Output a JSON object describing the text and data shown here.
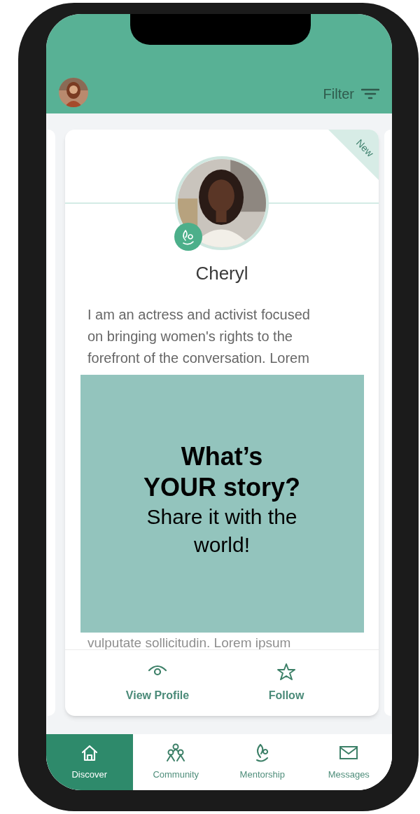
{
  "header": {
    "filter_label": "Filter"
  },
  "profile_card": {
    "badge": "New",
    "name": "Cheryl",
    "bio": "I am an actress and activist focused on bringing women's rights to the forefront of the conversation. Lorem",
    "bio_cut": "vulputate sollicitudin. Lorem ipsum",
    "actions": [
      {
        "label": "View Profile",
        "kind": "eye"
      },
      {
        "label": "Follow",
        "kind": "star"
      }
    ]
  },
  "promo_overlay": {
    "headline_lines": [
      "What’s",
      "YOUR story?"
    ],
    "subline": "Share it with the world!"
  },
  "bottom_nav": [
    {
      "label": "Discover",
      "kind": "home",
      "selected": true
    },
    {
      "label": "Community",
      "kind": "people",
      "selected": false
    },
    {
      "label": "Mentorship",
      "kind": "sprout",
      "selected": false
    },
    {
      "label": "Messages",
      "kind": "mail",
      "selected": false
    }
  ]
}
